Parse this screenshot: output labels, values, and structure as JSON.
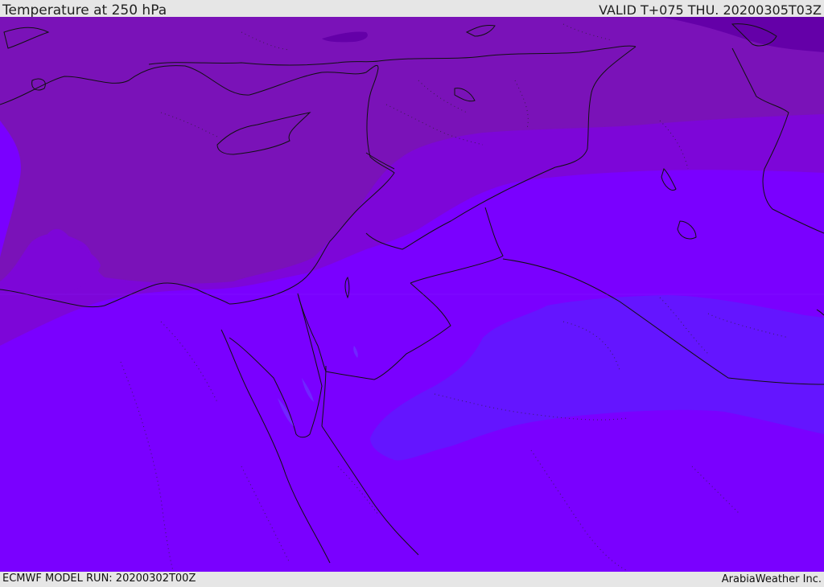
{
  "header": {
    "title": "Temperature at 250 hPa",
    "valid": "VALID T+075 THU. 20200305T03Z"
  },
  "footer": {
    "model_run": "ECMWF MODEL RUN: 20200302T00Z",
    "credit": "ArabiaWeather Inc."
  },
  "map": {
    "variable": "temperature",
    "level": "250 hPa",
    "region": "Eastern Mediterranean / Middle East",
    "colors": {
      "background": "#7a00ff",
      "coldest": "#6400a8",
      "cold": "#7a12b8",
      "medium_cold": "#7d06d8",
      "mild_band": "#7c00f0",
      "warm_patch": "#6415ff",
      "borders": "#111111"
    }
  }
}
